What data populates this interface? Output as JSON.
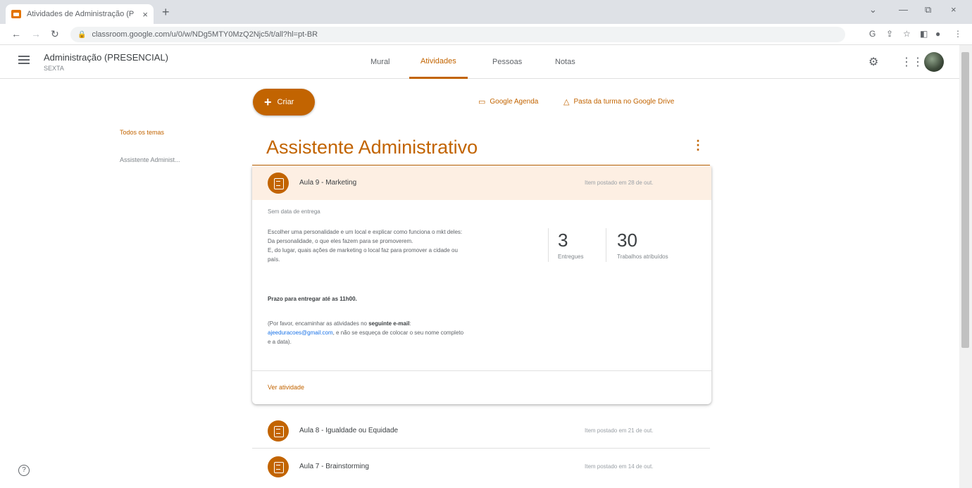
{
  "browser": {
    "tab_title": "Atividades de Administração (P",
    "tab_close": "×",
    "new_tab": "+",
    "url": "classroom.google.com/u/0/w/NDg5MTY0MzQ2Njc5/t/all?hl=pt-BR",
    "window": {
      "minimize": "—",
      "maximize": "⧉",
      "close": "×",
      "tablist": "⌄"
    }
  },
  "header": {
    "class_name": "Administração (PRESENCIAL)",
    "class_section": "SEXTA",
    "tabs": [
      {
        "label": "Mural"
      },
      {
        "label": "Atividades"
      },
      {
        "label": "Pessoas"
      },
      {
        "label": "Notas"
      }
    ]
  },
  "sidebar": {
    "all_topics": "Todos os temas",
    "topics": [
      "Assistente Administ..."
    ]
  },
  "toolbar": {
    "create_label": "Criar",
    "calendar_link": "Google Agenda",
    "drive_link": "Pasta da turma no Google Drive"
  },
  "topic": {
    "title": "Assistente Administrativo",
    "expanded": {
      "title": "Aula 9 - Marketing",
      "posted": "Item postado em 28 de out.",
      "no_due": "Sem data de entrega",
      "description": [
        "Escolher uma personalidade e um local e explicar como funciona o mkt deles:",
        "Da personalidade, o que eles fazem para se promoverem.",
        "E, do lugar, quais ações de marketing o local faz para promover a cidade ou",
        "país."
      ],
      "deadline": "Prazo para entregar até as 11h00.",
      "request_prefix": "(Por favor, encaminhar as atividades no ",
      "request_bold": "seguinte e-mail",
      "request_email": "ajeeduracoes@gmail.com",
      "request_suffix": ", e não se esqueça de colocar o seu nome completo",
      "request_end": "e a data).",
      "stats": [
        {
          "value": "3",
          "label": "Entregues"
        },
        {
          "value": "30",
          "label": "Trabalhos atribuídos"
        }
      ],
      "view_link": "Ver atividade"
    },
    "items": [
      {
        "title": "Aula 8 - Igualdade ou Equidade",
        "posted": "Item postado em 21 de out."
      },
      {
        "title": "Aula 7 - Brainstorming",
        "posted": "Item postado em 14 de out."
      }
    ]
  },
  "colors": {
    "accent": "#c26401",
    "card_highlight": "#fdefe3"
  }
}
